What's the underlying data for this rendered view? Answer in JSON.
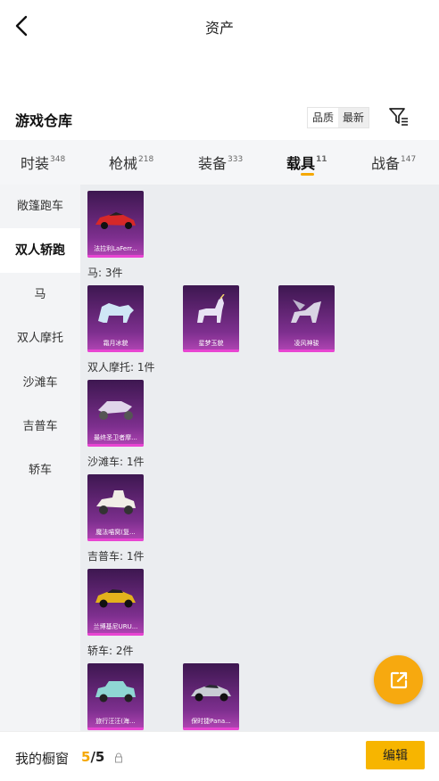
{
  "header": {
    "title": "资产",
    "back_icon": "chevron-left-icon"
  },
  "warehouse": {
    "title": "游戏仓库",
    "sort_options": [
      "品质",
      "最新"
    ],
    "active_sort": "最新",
    "filter_icon": "filter-icon"
  },
  "tabs": [
    {
      "label": "时装",
      "count": "348"
    },
    {
      "label": "枪械",
      "count": "218"
    },
    {
      "label": "装备",
      "count": "333"
    },
    {
      "label": "载具",
      "count": "11",
      "active": true
    },
    {
      "label": "战备",
      "count": "147"
    }
  ],
  "sidebar": {
    "items": [
      "敞篷跑车",
      "双人轿跑",
      "马",
      "双人摩托",
      "沙滩车",
      "吉普车",
      "轿车"
    ],
    "active": "双人轿跑"
  },
  "groups": [
    {
      "label": "",
      "items": [
        "法拉利LaFerr..."
      ]
    },
    {
      "label": "马: 3件",
      "items": [
        "霜月冰貌",
        "星梦玉貌",
        "凌风神骏"
      ]
    },
    {
      "label": "双人摩托: 1件",
      "items": [
        "最终圣卫者摩..."
      ]
    },
    {
      "label": "沙滩车: 1件",
      "items": [
        "魔法喵窝(复..."
      ]
    },
    {
      "label": "吉普车: 1件",
      "items": [
        "兰博基尼URU..."
      ]
    },
    {
      "label": "轿车: 2件",
      "items": [
        "旅行汪汪(海...",
        "保时捷Pana..."
      ]
    }
  ],
  "fab": {
    "icon": "share-external-icon"
  },
  "bottom": {
    "label": "我的橱窗",
    "count_current": "5",
    "count_total": "/5",
    "edit_label": "编辑"
  },
  "colors": {
    "accent": "#f5a800",
    "card_purple": "#7d2f8e",
    "sidebar_bg": "#f3f4f6",
    "content_bg": "#ebedf0"
  }
}
